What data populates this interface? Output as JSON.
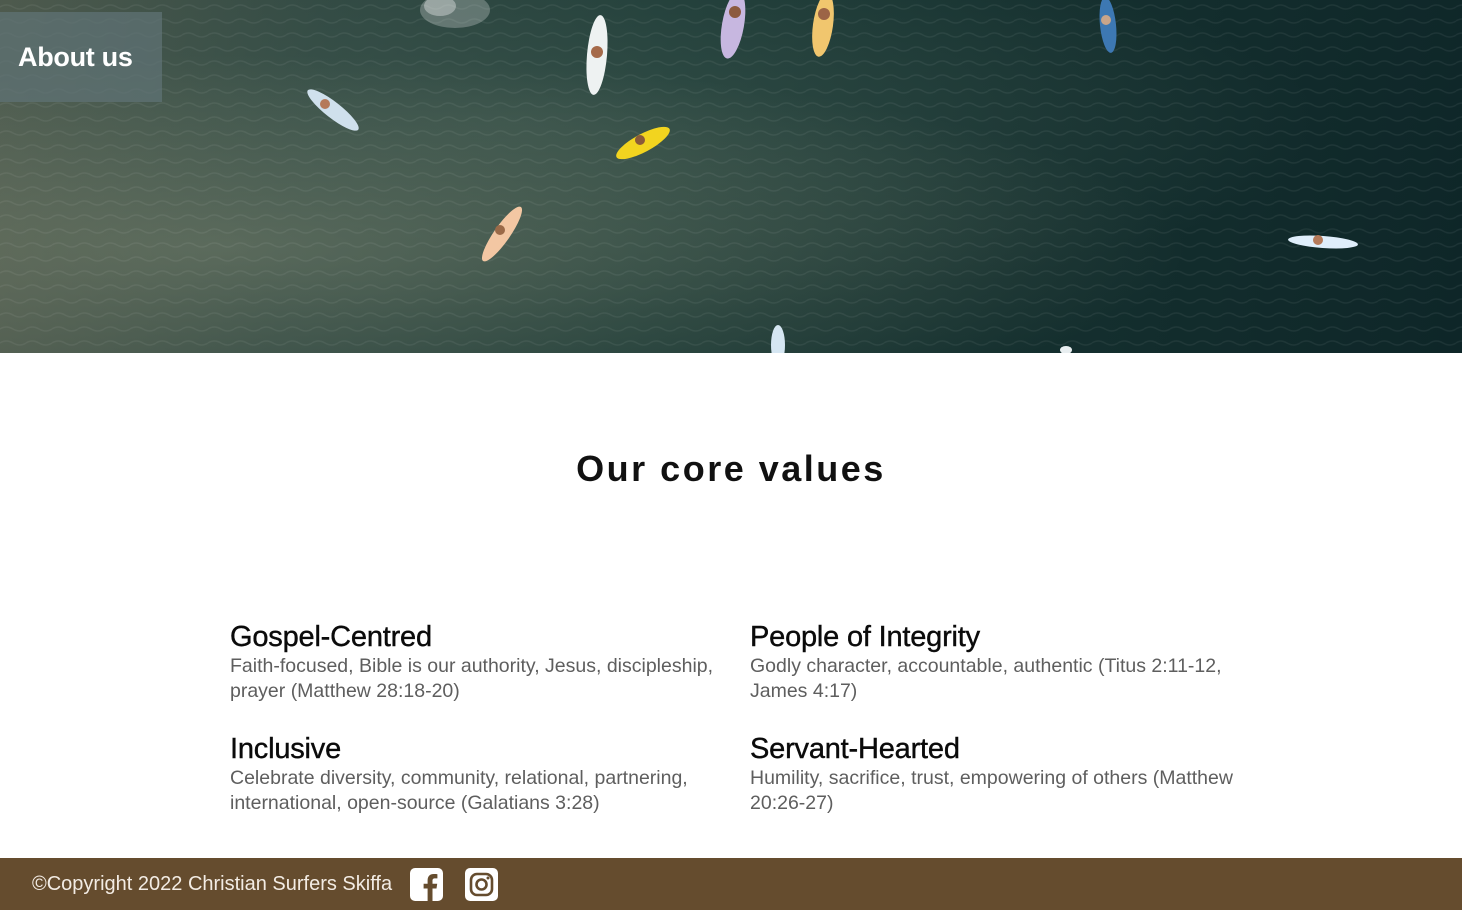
{
  "hero": {
    "nav_label": "About us"
  },
  "main": {
    "section_title": "Our core values",
    "values": [
      {
        "title": "Gospel-Centred",
        "description": "Faith-focused, Bible is our authority, Jesus, discipleship, prayer (Matthew 28:18-20)"
      },
      {
        "title": "People of Integrity",
        "description": "Godly character, accountable, authentic (Titus 2:11-12, James 4:17)"
      },
      {
        "title": "Inclusive",
        "description": "Celebrate diversity, community, relational, partnering, international, open-source (Galatians 3:28)"
      },
      {
        "title": "Servant-Hearted",
        "description": "Humility, sacrifice, trust, empowering of others (Matthew 20:26-27)"
      }
    ]
  },
  "footer": {
    "copyright": "©Copyright 2022 Christian Surfers Skiffa",
    "social": [
      {
        "icon": "facebook-icon"
      },
      {
        "icon": "instagram-icon"
      }
    ]
  },
  "colors": {
    "footer_bg": "#654c2e",
    "footer_text": "#f3ece4",
    "ocean_dark": "#15302f",
    "nav_tab": "#5f7376"
  }
}
